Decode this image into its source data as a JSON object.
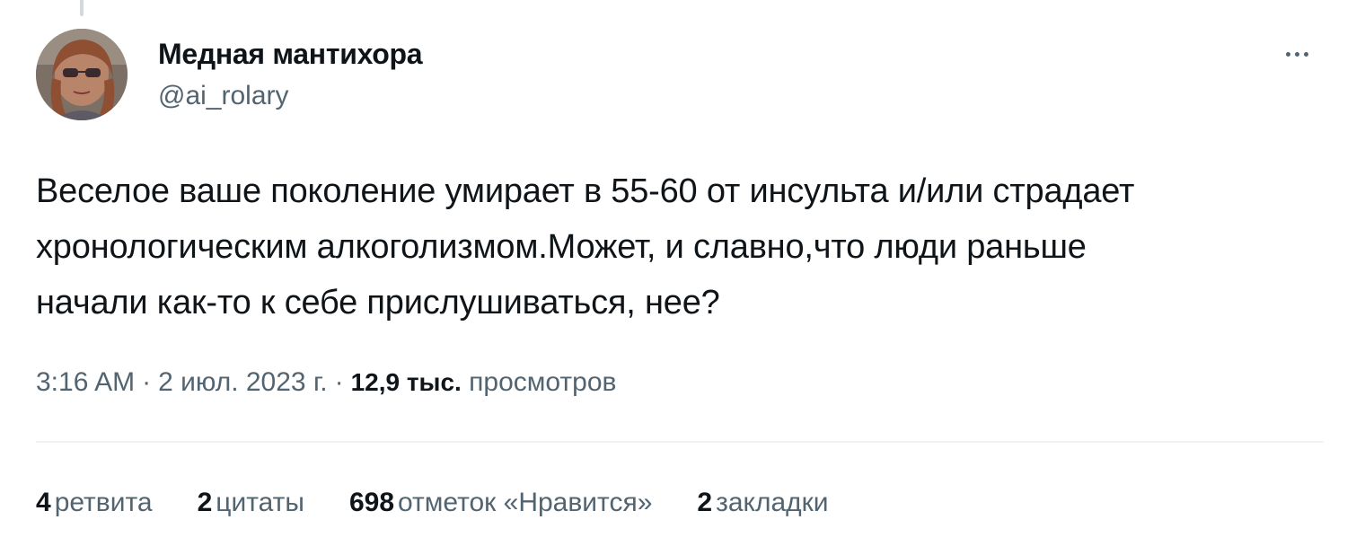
{
  "author": {
    "display_name": "Медная мантихора",
    "handle": "@ai_rolary"
  },
  "tweet": {
    "lines": [
      "Веселое ваше поколение умирает в 55-60 от инсульта и/или страдает",
      "хронологическим алкоголизмом.Может, и славно,что люди раньше",
      "начали как-то к себе прислушиваться, нее?"
    ]
  },
  "meta": {
    "time": "3:16 AM",
    "separator": "·",
    "date": "2 июл. 2023 г.",
    "views_count": "12,9 тыс.",
    "views_label": "просмотров"
  },
  "stats": {
    "retweets": {
      "count": "4",
      "label": "ретвита"
    },
    "quotes": {
      "count": "2",
      "label": "цитаты"
    },
    "likes": {
      "count": "698",
      "label": "отметок «Нравится»"
    },
    "bookmarks": {
      "count": "2",
      "label": "закладки"
    }
  },
  "icons": {
    "more": "more-horizontal-icon",
    "avatar": "profile-photo"
  },
  "colors": {
    "text_primary": "#0f1419",
    "text_secondary": "#536471",
    "divider": "#eff3f4"
  }
}
